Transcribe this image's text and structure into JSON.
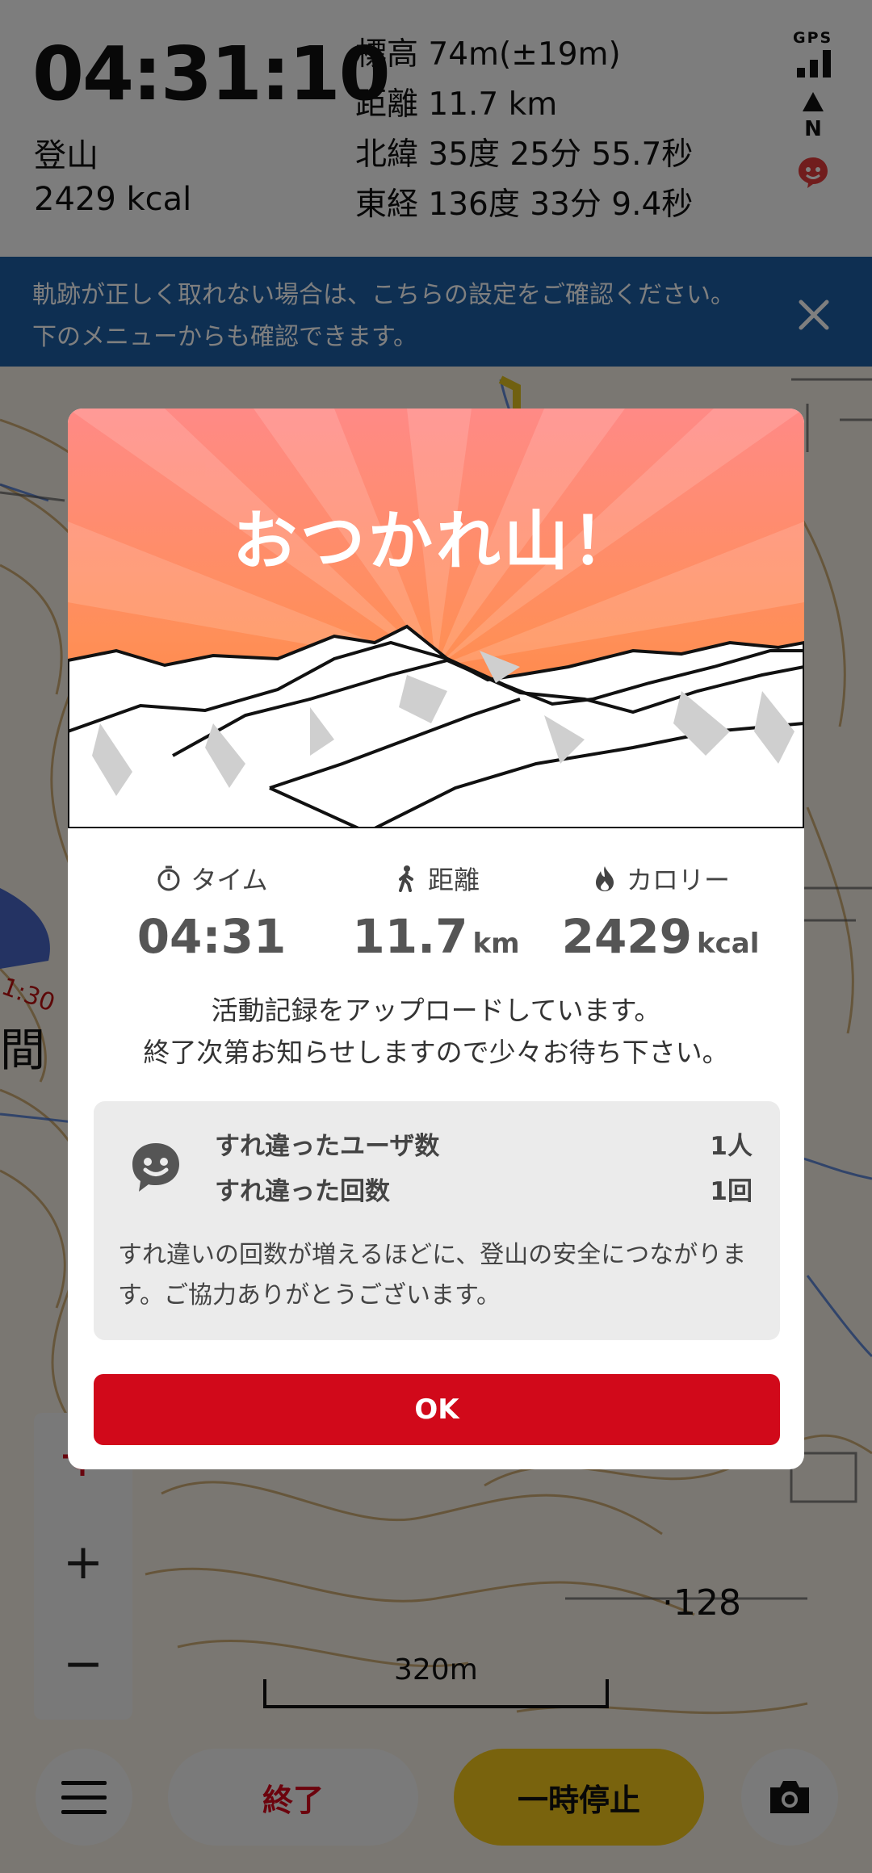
{
  "status": {
    "elapsed_time": "04:31:10",
    "activity": "登山",
    "calories": "2429 kcal",
    "altitude": "標高 74m(±19m)",
    "distance": "距離 11.7 km",
    "latitude": "北緯 35度 25分 55.7秒",
    "longitude": "東経 136度 33分 9.4秒",
    "gps_label": "GPS",
    "north_label": "N"
  },
  "notice": {
    "text": "軌跡が正しく取れない場合は、こちらの設定をご確認ください。下のメニューからも確認できます。"
  },
  "map": {
    "scale_label": "320m",
    "elevation_label": "128",
    "time_marker": "1:30",
    "place_char": "間"
  },
  "controls": {
    "zoom_in": "+",
    "zoom_out": "−",
    "end_label": "終了",
    "pause_label": "一時停止"
  },
  "modal": {
    "title": "おつかれ山！",
    "stats": [
      {
        "label": "タイム",
        "value": "04:31",
        "unit": "",
        "icon": "stopwatch-icon"
      },
      {
        "label": "距離",
        "value": "11.7",
        "unit": "km",
        "icon": "walker-icon"
      },
      {
        "label": "カロリー",
        "value": "2429",
        "unit": "kcal",
        "icon": "flame-icon"
      }
    ],
    "upload_line1": "活動記録をアップロードしています。",
    "upload_line2": "終了次第お知らせしますので少々お待ち下さい。",
    "encounter": {
      "users_label": "すれ違ったユーザ数",
      "users_value": "1人",
      "count_label": "すれ違った回数",
      "count_value": "1回",
      "note": "すれ違いの回数が増えるほどに、登山の安全につながります。ご協力ありがとうございます。"
    },
    "ok_label": "OK"
  },
  "colors": {
    "accent_red": "#d1091a",
    "notice_blue": "#1d5fa5",
    "pause_yellow": "#f3c61a",
    "sunrise_orange": "#ff7f3a"
  }
}
